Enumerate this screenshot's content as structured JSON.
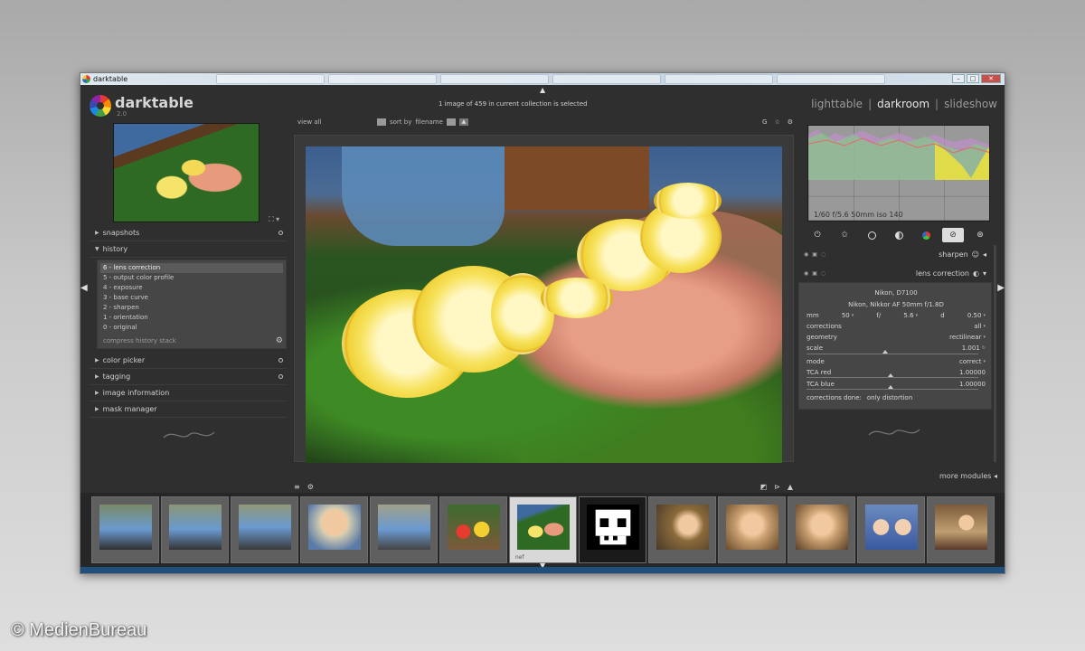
{
  "window": {
    "title": "darktable"
  },
  "header": {
    "logo_text": "darktable",
    "version": "2.0",
    "collection_info": "1 image of 459 in current collection is selected",
    "views": {
      "lighttable": "lighttable",
      "sep1": "|",
      "darkroom": "darkroom",
      "sep2": "|",
      "slideshow": "slideshow",
      "active": "darkroom"
    }
  },
  "toolbar": {
    "view_label": "view",
    "view_value": "all",
    "sort_label": "sort by",
    "sort_value": "filename",
    "grouping_label": "G"
  },
  "left_panel": {
    "modules": [
      {
        "label": "snapshots"
      },
      {
        "label": "history"
      },
      {
        "label": "color picker"
      },
      {
        "label": "tagging"
      },
      {
        "label": "image information"
      },
      {
        "label": "mask manager"
      }
    ],
    "history": [
      "6 - lens correction",
      "5 - output color profile",
      "4 - exposure",
      "3 - base curve",
      "2 - sharpen",
      "1 - orientation",
      "0 - original"
    ],
    "compress_label": "compress history stack"
  },
  "right_panel": {
    "histogram_info": "1/60 f/5.6 50mm iso 140",
    "sharpen_label": "sharpen",
    "lens_label": "lens correction",
    "lens": {
      "camera": "Nikon, D7100",
      "lens": "Nikon, Nikkor AF 50mm f/1.8D",
      "mm_label": "mm",
      "mm_value": "50",
      "f_label": "f/",
      "f_value": "5.6",
      "d_label": "d",
      "d_value": "0.50",
      "corrections_label": "corrections",
      "corrections_value": "all",
      "geometry_label": "geometry",
      "geometry_value": "rectilinear",
      "scale_label": "scale",
      "scale_value": "1.001",
      "mode_label": "mode",
      "mode_value": "correct",
      "tca_red_label": "TCA red",
      "tca_red_value": "1.00000",
      "tca_blue_label": "TCA blue",
      "tca_blue_value": "1.00000",
      "done_label": "corrections done:",
      "done_value": "only distortion"
    },
    "more_modules": "more modules"
  },
  "filmstrip": {
    "selected_caption": "nef",
    "selected_index": 6,
    "count": 13
  },
  "watermark": "© MedienBureau"
}
